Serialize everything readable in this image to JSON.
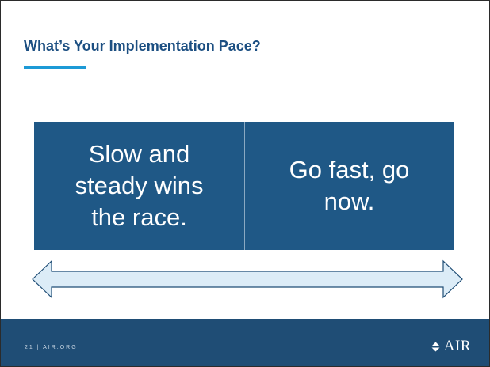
{
  "slide": {
    "title": "What’s Your Implementation Pace?",
    "left_box": {
      "lines": [
        "Slow and",
        "steady wins",
        "the race."
      ]
    },
    "right_box": {
      "lines": [
        "Go fast, go",
        "now."
      ]
    }
  },
  "footer": {
    "page_label": "21 | AIR.ORG",
    "logo_text": "AIR"
  },
  "colors": {
    "title": "#1c4f82",
    "accent": "#1d9ad6",
    "box_fill": "#1f5886",
    "footer_fill": "#1f4d75",
    "arrow_fill": "#dcecf7",
    "arrow_stroke": "#1f4d75"
  }
}
